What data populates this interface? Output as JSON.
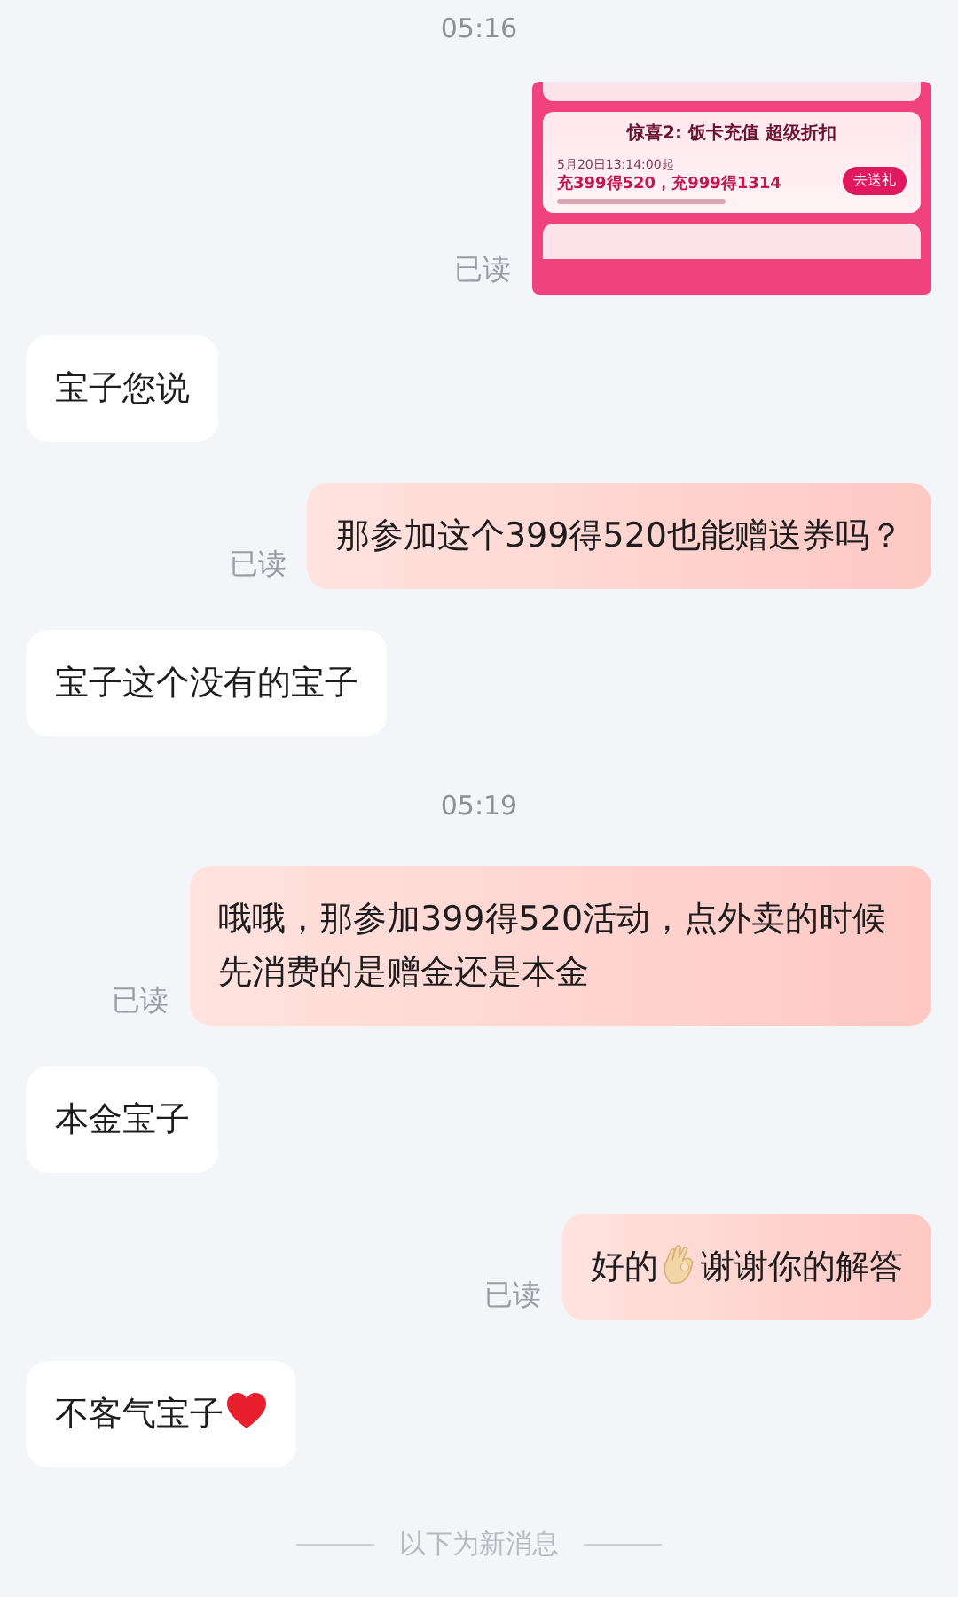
{
  "messages": [
    {
      "kind": "time",
      "text": "05:16"
    },
    {
      "kind": "image_out",
      "read": true,
      "read_label": "已读",
      "card": {
        "title": "惊喜2: 饭卡充值 超级折扣",
        "date": "5月20日13:14:00起",
        "offer": "充399得520，充999得1314",
        "button": "去送礼"
      }
    },
    {
      "kind": "in",
      "segments": [
        {
          "kind": "text",
          "text": "宝子您说"
        }
      ]
    },
    {
      "kind": "out",
      "read": true,
      "read_label": "已读",
      "segments": [
        {
          "kind": "text",
          "text": "那参加这个399得520也能赠送券吗？"
        }
      ]
    },
    {
      "kind": "in",
      "segments": [
        {
          "kind": "text",
          "text": "宝子这个没有的宝子"
        }
      ]
    },
    {
      "kind": "time",
      "text": "05:19"
    },
    {
      "kind": "out",
      "read": true,
      "read_label": "已读",
      "segments": [
        {
          "kind": "text",
          "text": "哦哦，那参加399得520活动，点外卖的时候先消费的是赠金还是本金"
        }
      ]
    },
    {
      "kind": "in",
      "segments": [
        {
          "kind": "text",
          "text": "本金宝子"
        }
      ]
    },
    {
      "kind": "out",
      "read": true,
      "read_label": "已读",
      "segments": [
        {
          "kind": "text",
          "text": "好的"
        },
        {
          "kind": "ok_hand"
        },
        {
          "kind": "text",
          "text": "谢谢你的解答"
        }
      ]
    },
    {
      "kind": "in",
      "segments": [
        {
          "kind": "text",
          "text": "不客气宝子"
        },
        {
          "kind": "heart"
        }
      ]
    },
    {
      "kind": "divider",
      "text": "以下为新消息"
    }
  ]
}
